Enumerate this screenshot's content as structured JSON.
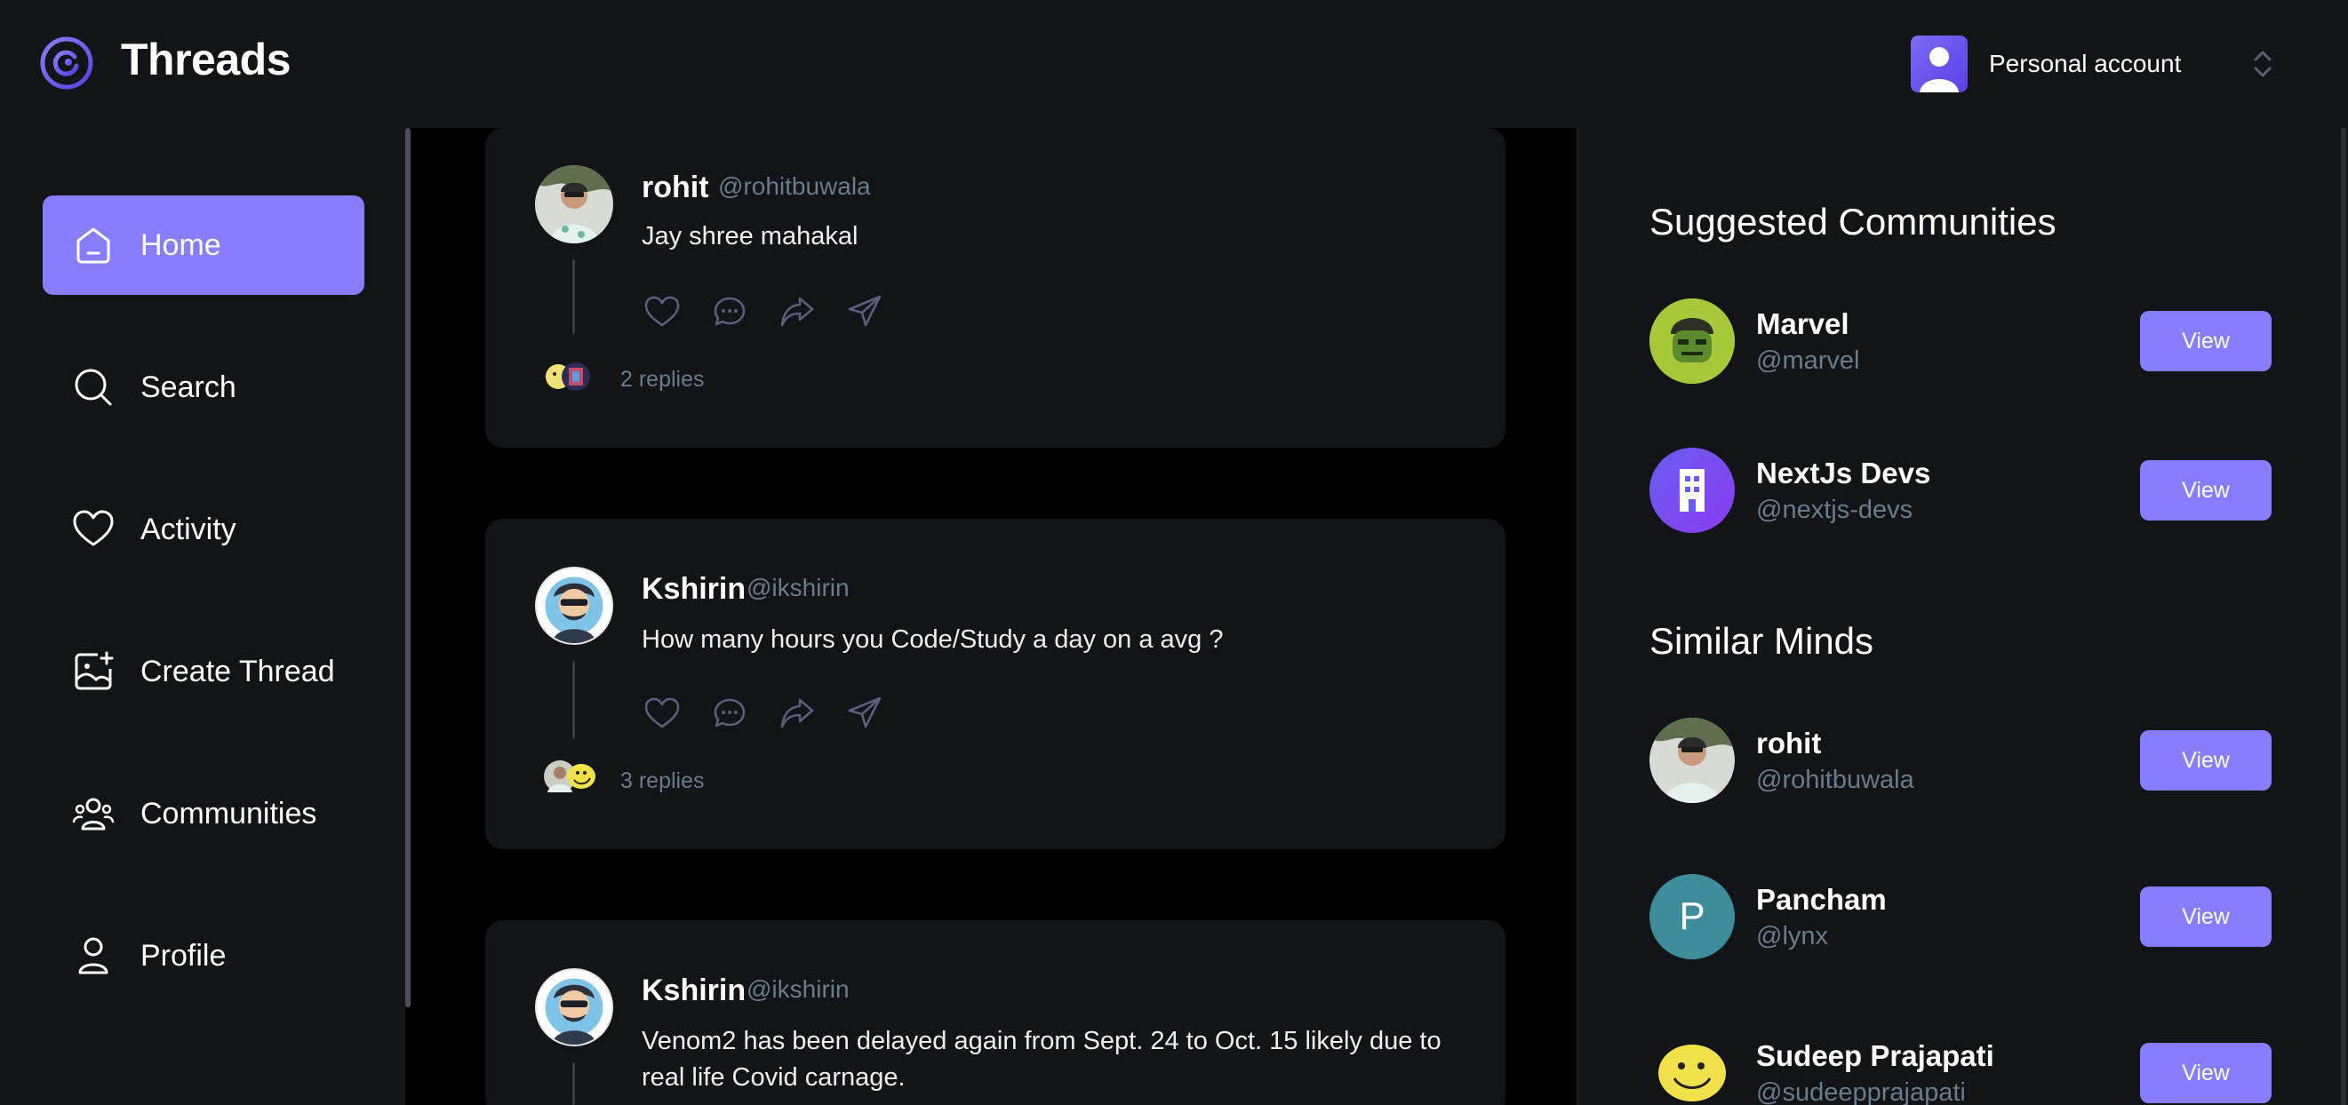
{
  "app": {
    "brand": "Threads"
  },
  "account": {
    "label": "Personal account"
  },
  "sidebar": {
    "items": [
      {
        "label": "Home",
        "icon": "home-icon",
        "active": true
      },
      {
        "label": "Search",
        "icon": "search-icon"
      },
      {
        "label": "Activity",
        "icon": "heart-icon"
      },
      {
        "label": "Create Thread",
        "icon": "create-thread-icon"
      },
      {
        "label": "Communities",
        "icon": "communities-icon"
      },
      {
        "label": "Profile",
        "icon": "user-icon"
      }
    ]
  },
  "feed": {
    "threads": [
      {
        "author": "rohit",
        "handle": "@rohitbuwala",
        "text": "Jay shree mahakal",
        "replies": "2 replies"
      },
      {
        "author": "Kshirin",
        "handle": "@ikshirin",
        "text": "How many hours you Code/Study a day on a avg ?",
        "replies": "3 replies"
      },
      {
        "author": "Kshirin",
        "handle": "@ikshirin",
        "text": "Venom2 has been delayed again from Sept. 24 to Oct. 15 likely due to real life Covid carnage."
      }
    ]
  },
  "right": {
    "suggested_title": "Suggested Communities",
    "communities": [
      {
        "name": "Marvel",
        "handle": "@marvel",
        "button": "View"
      },
      {
        "name": "NextJs Devs",
        "handle": "@nextjs-devs",
        "button": "View"
      }
    ],
    "similar_title": "Similar Minds",
    "users": [
      {
        "name": "rohit",
        "handle": "@rohitbuwala",
        "button": "View"
      },
      {
        "name": "Pancham",
        "handle": "@lynx",
        "button": "View",
        "initial": "P"
      },
      {
        "name": "Sudeep Prajapati",
        "handle": "@sudeepprajapati",
        "button": "View"
      }
    ]
  },
  "colors": {
    "accent": "#877eff",
    "surface": "#121417",
    "muted": "#697c89",
    "background": "#000000"
  }
}
